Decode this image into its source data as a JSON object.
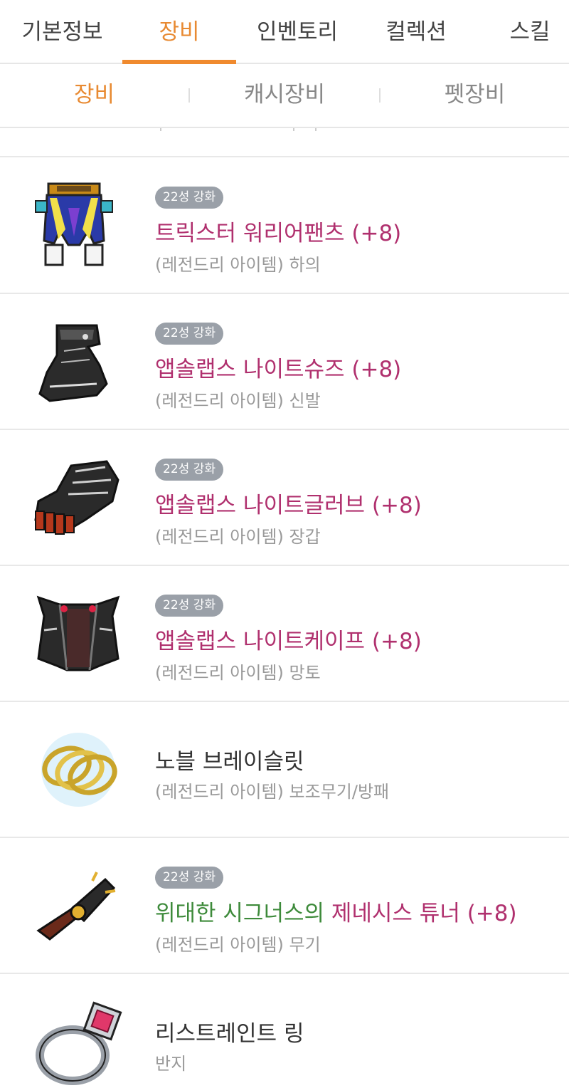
{
  "tabs": [
    "기본정보",
    "장비",
    "인벤토리",
    "컬렉션",
    "스킬"
  ],
  "subtabs": [
    "장비",
    "캐시장비",
    "펫장비"
  ],
  "colors": {
    "accent": "#e88a32",
    "item_name": "#b0306e",
    "set_name": "#3d8a3a",
    "badge_bg": "#9aa0a8"
  },
  "items": [
    {
      "icon": "pants-icon",
      "badge": "22성 강화",
      "name": "트릭스터 워리어팬츠 (+8)",
      "desc": "(레전드리 아이템) 하의"
    },
    {
      "icon": "shoes-icon",
      "badge": "22성 강화",
      "name": "앱솔랩스 나이트슈즈 (+8)",
      "desc": "(레전드리 아이템) 신발"
    },
    {
      "icon": "gloves-icon",
      "badge": "22성 강화",
      "name": "앱솔랩스 나이트글러브 (+8)",
      "desc": "(레전드리 아이템) 장갑"
    },
    {
      "icon": "cape-icon",
      "badge": "22성 강화",
      "name": "앱솔랩스 나이트케이프 (+8)",
      "desc": "(레전드리 아이템) 망토"
    },
    {
      "icon": "bracelet-icon",
      "name": "노블 브레이슬릿",
      "desc": "(레전드리 아이템) 보조무기/방패"
    },
    {
      "icon": "weapon-icon",
      "badge": "22성 강화",
      "name_prefix": "위대한 시그너스의",
      "name_main": "제네시스 튜너 (+8)",
      "desc": "(레전드리 아이템) 무기"
    },
    {
      "icon": "ring-icon",
      "name": "리스트레인트 링",
      "desc": "반지"
    }
  ]
}
